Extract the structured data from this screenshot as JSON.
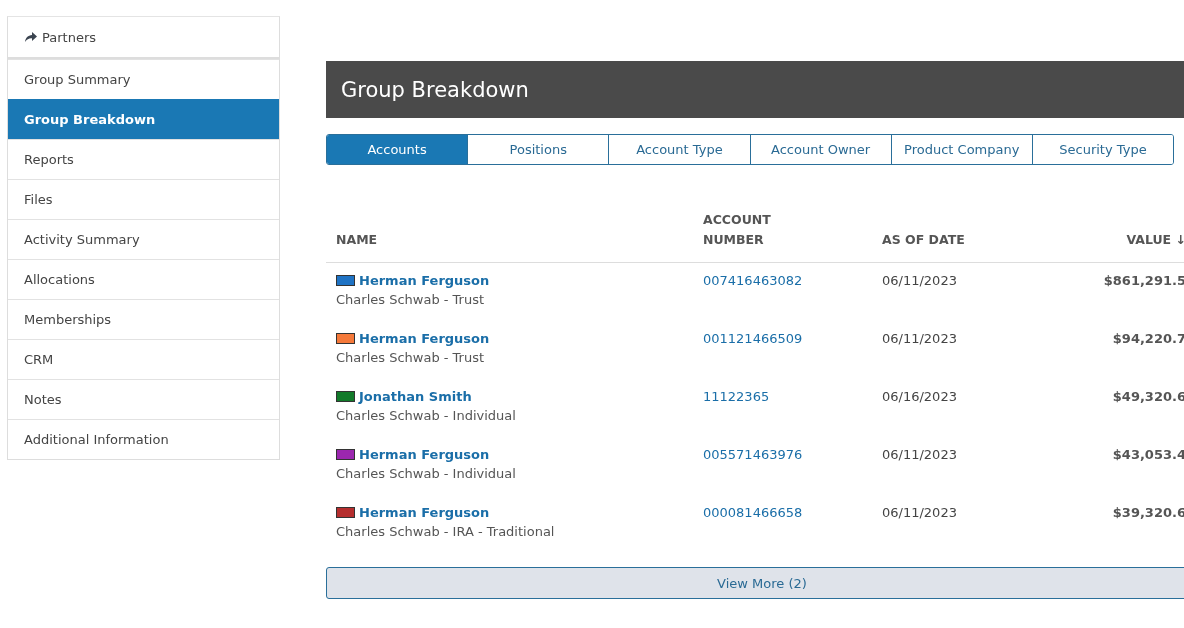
{
  "sidebar": {
    "header": {
      "label": "Partners"
    },
    "items": [
      {
        "label": "Group Summary",
        "selected": false
      },
      {
        "label": "Group Breakdown",
        "selected": true
      },
      {
        "label": "Reports",
        "selected": false
      },
      {
        "label": "Files",
        "selected": false
      },
      {
        "label": "Activity Summary",
        "selected": false
      },
      {
        "label": "Allocations",
        "selected": false
      },
      {
        "label": "Memberships",
        "selected": false
      },
      {
        "label": "CRM",
        "selected": false
      },
      {
        "label": "Notes",
        "selected": false
      },
      {
        "label": "Additional Information",
        "selected": false
      }
    ]
  },
  "section": {
    "title": "Group Breakdown"
  },
  "tabs": [
    {
      "label": "Accounts",
      "selected": true
    },
    {
      "label": "Positions",
      "selected": false
    },
    {
      "label": "Account Type",
      "selected": false
    },
    {
      "label": "Account Owner",
      "selected": false
    },
    {
      "label": "Product Company",
      "selected": false
    },
    {
      "label": "Security Type",
      "selected": false
    }
  ],
  "table": {
    "columns": [
      {
        "label": "NAME"
      },
      {
        "label": "ACCOUNT NUMBER"
      },
      {
        "label": "AS OF DATE"
      },
      {
        "label": "VALUE ↓"
      }
    ],
    "rows": [
      {
        "color": "#1f73c4",
        "name": "Herman Ferguson",
        "detail": "Charles Schwab - Trust",
        "account_number": "007416463082",
        "as_of_date": "06/11/2023",
        "value": "$861,291.5"
      },
      {
        "color": "#f5793a",
        "name": "Herman Ferguson",
        "detail": "Charles Schwab - Trust",
        "account_number": "001121466509",
        "as_of_date": "06/11/2023",
        "value": "$94,220.7"
      },
      {
        "color": "#127a2a",
        "name": "Jonathan Smith",
        "detail": "Charles Schwab - Individual",
        "account_number": "11122365",
        "as_of_date": "06/16/2023",
        "value": "$49,320.6"
      },
      {
        "color": "#9b27af",
        "name": "Herman Ferguson",
        "detail": "Charles Schwab - Individual",
        "account_number": "005571463976",
        "as_of_date": "06/11/2023",
        "value": "$43,053.4"
      },
      {
        "color": "#b52e2e",
        "name": "Herman Ferguson",
        "detail": "Charles Schwab - IRA - Traditional",
        "account_number": "000081466658",
        "as_of_date": "06/11/2023",
        "value": "$39,320.6"
      }
    ]
  },
  "view_more": {
    "label": "View More (2)"
  }
}
